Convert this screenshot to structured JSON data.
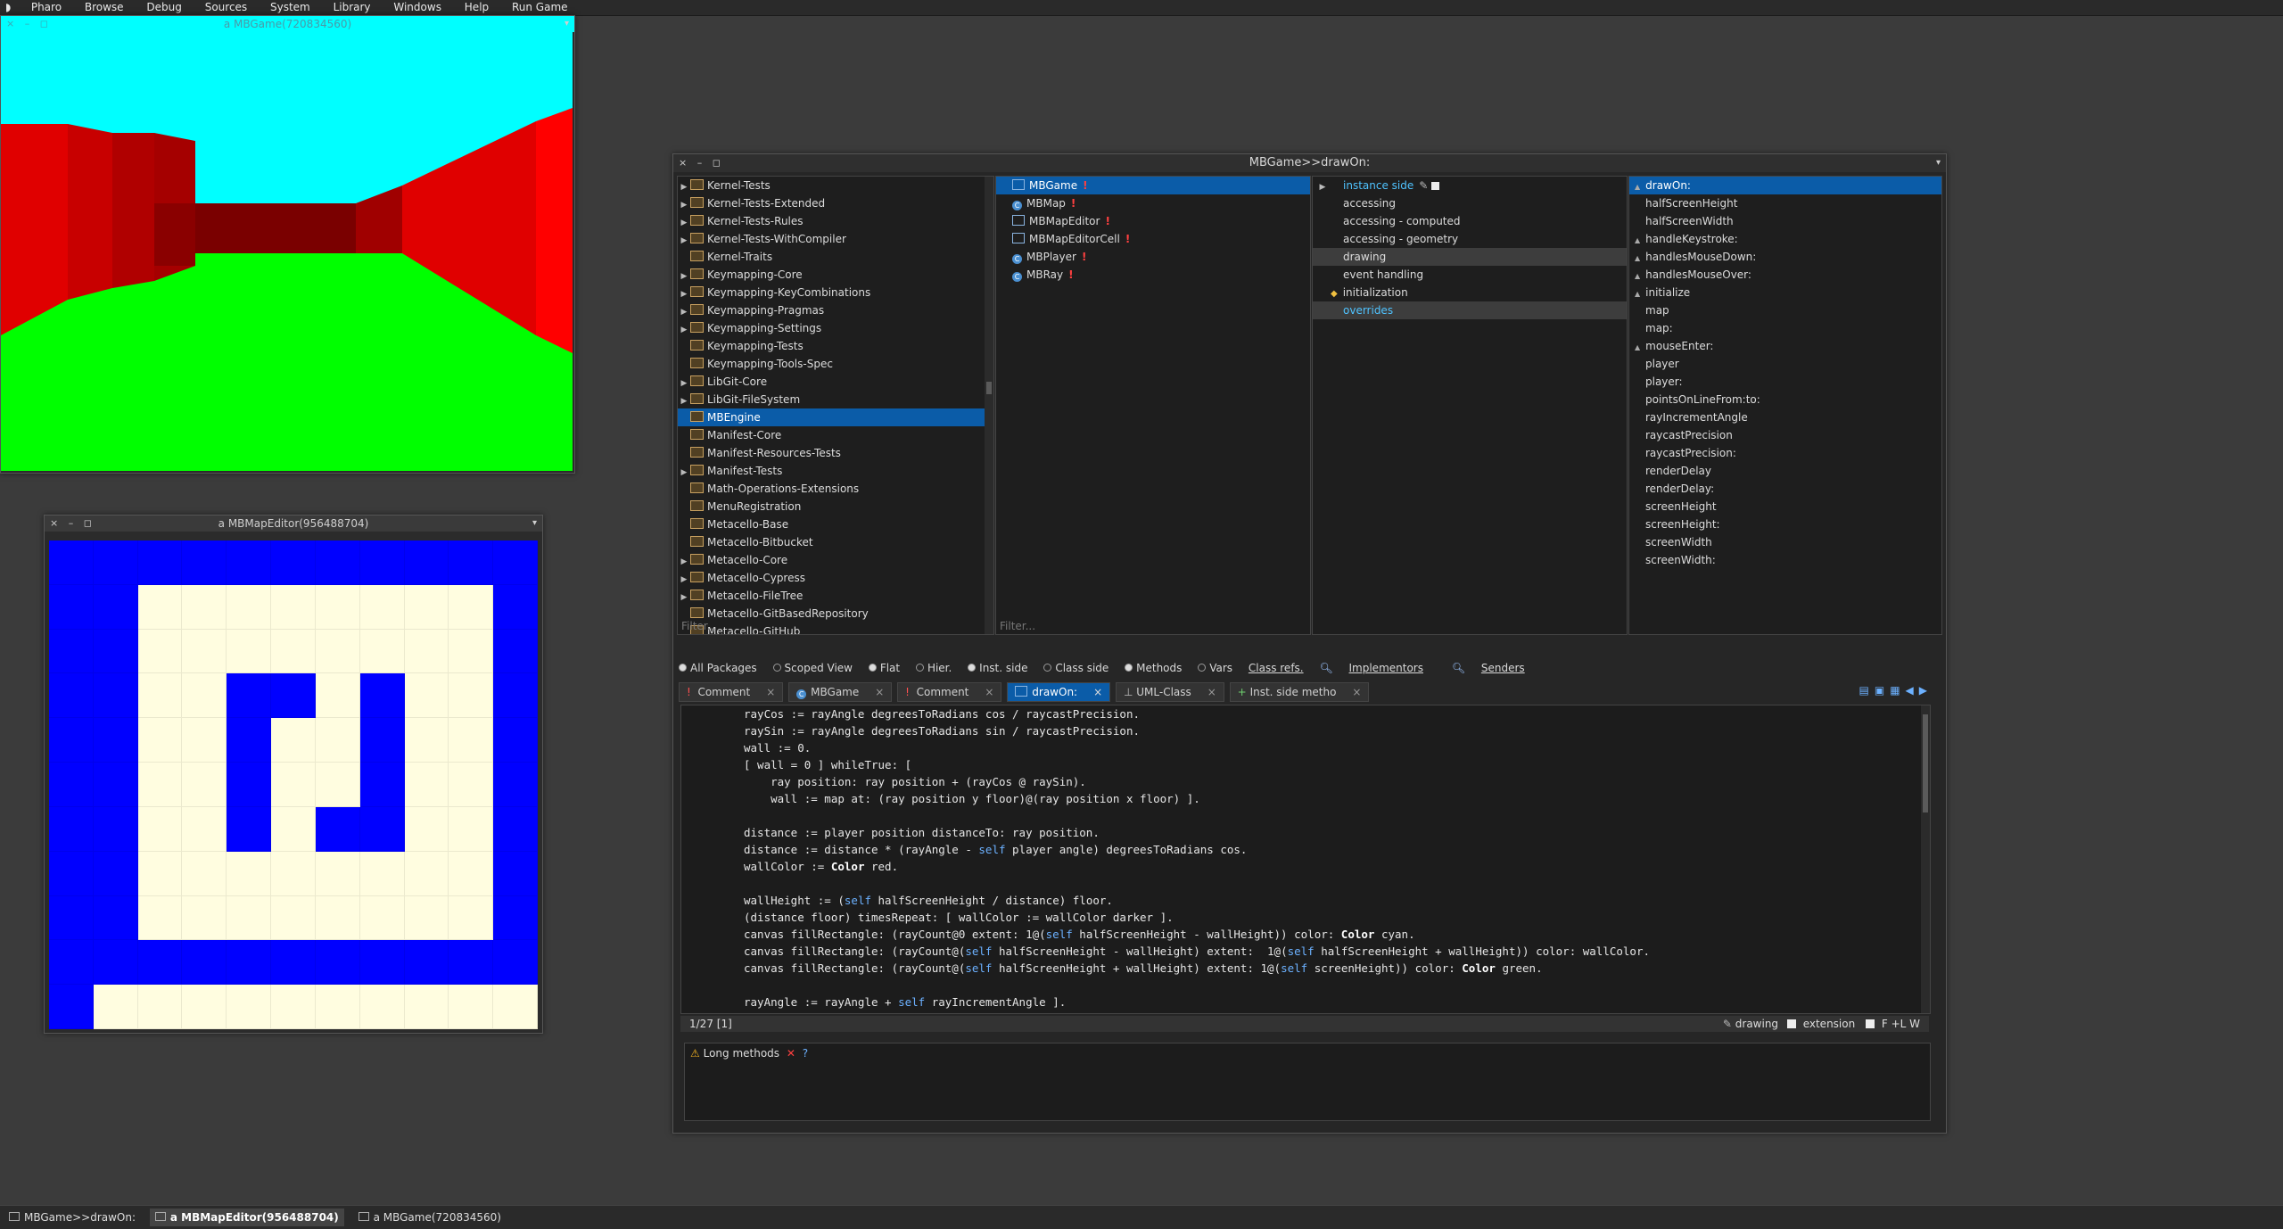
{
  "menubar": [
    "Pharo",
    "Browse",
    "Debug",
    "Sources",
    "System",
    "Library",
    "Windows",
    "Help",
    "Run Game"
  ],
  "game_window": {
    "title": "a MBGame(720834560)"
  },
  "map_window": {
    "title": "a MBMapEditor(956488704)",
    "grid": [
      "BBBBBBBBBBB",
      "BBCCCCCCCCB",
      "BBCCCCCCCCB",
      "BBCCBBCBCCB",
      "BBCCBCCBCCB",
      "BBCCBCCBCCB",
      "BBCCBCBBCCB",
      "BBCCCCCCCCB",
      "BBCCCCCCCCB",
      "BBBBBBBBBBB",
      "BCCCCCCCCCC"
    ],
    "colors": {
      "B": "#0000ff",
      "C": "#fffde0"
    }
  },
  "browser": {
    "title": "MBGame>>drawOn:",
    "packages": [
      "Kernel-Tests",
      "Kernel-Tests-Extended",
      "Kernel-Tests-Rules",
      "Kernel-Tests-WithCompiler",
      "Kernel-Traits",
      "Keymapping-Core",
      "Keymapping-KeyCombinations",
      "Keymapping-Pragmas",
      "Keymapping-Settings",
      "Keymapping-Tests",
      "Keymapping-Tools-Spec",
      "LibGit-Core",
      "LibGit-FileSystem",
      "MBEngine",
      "Manifest-Core",
      "Manifest-Resources-Tests",
      "Manifest-Tests",
      "Math-Operations-Extensions",
      "MenuRegistration",
      "Metacello-Base",
      "Metacello-Bitbucket",
      "Metacello-Core",
      "Metacello-Cypress",
      "Metacello-FileTree",
      "Metacello-GitBasedRepository",
      "Metacello-GitHub"
    ],
    "classes": [
      "MBGame",
      "MBMap",
      "MBMapEditor",
      "MBMapEditorCell",
      "MBPlayer",
      "MBRay"
    ],
    "protocols": [
      "instance side",
      "accessing",
      "accessing - computed",
      "accessing - geometry",
      "drawing",
      "event handling",
      "initialization",
      "overrides"
    ],
    "methods": [
      "drawOn:",
      "halfScreenHeight",
      "halfScreenWidth",
      "handleKeystroke:",
      "handlesMouseDown:",
      "handlesMouseOver:",
      "initialize",
      "map",
      "map:",
      "mouseEnter:",
      "player",
      "player:",
      "pointsOnLineFrom:to:",
      "rayIncrementAngle",
      "raycastPrecision",
      "raycastPrecision:",
      "renderDelay",
      "renderDelay:",
      "screenHeight",
      "screenHeight:",
      "screenWidth",
      "screenWidth:"
    ],
    "filter_placeholder": "Filter...",
    "options": {
      "all_packages": "All Packages",
      "scoped_view": "Scoped View",
      "flat": "Flat",
      "hier": "Hier.",
      "inst_side": "Inst. side",
      "class_side": "Class side",
      "methods": "Methods",
      "vars": "Vars",
      "class_refs": "Class refs.",
      "implementors": "Implementors",
      "senders": "Senders"
    },
    "tabs": [
      "Comment",
      "MBGame",
      "Comment",
      "drawOn:",
      "UML-Class",
      "Inst. side metho"
    ],
    "status": {
      "position": "1/27 [1]",
      "protocol": "drawing",
      "extension": "extension",
      "flags": "F +L W"
    },
    "critic": {
      "label": "Long methods",
      "help": "?"
    }
  },
  "taskbar": [
    "MBGame>>drawOn:",
    "a MBMapEditor(956488704)",
    "a MBGame(720834560)"
  ]
}
